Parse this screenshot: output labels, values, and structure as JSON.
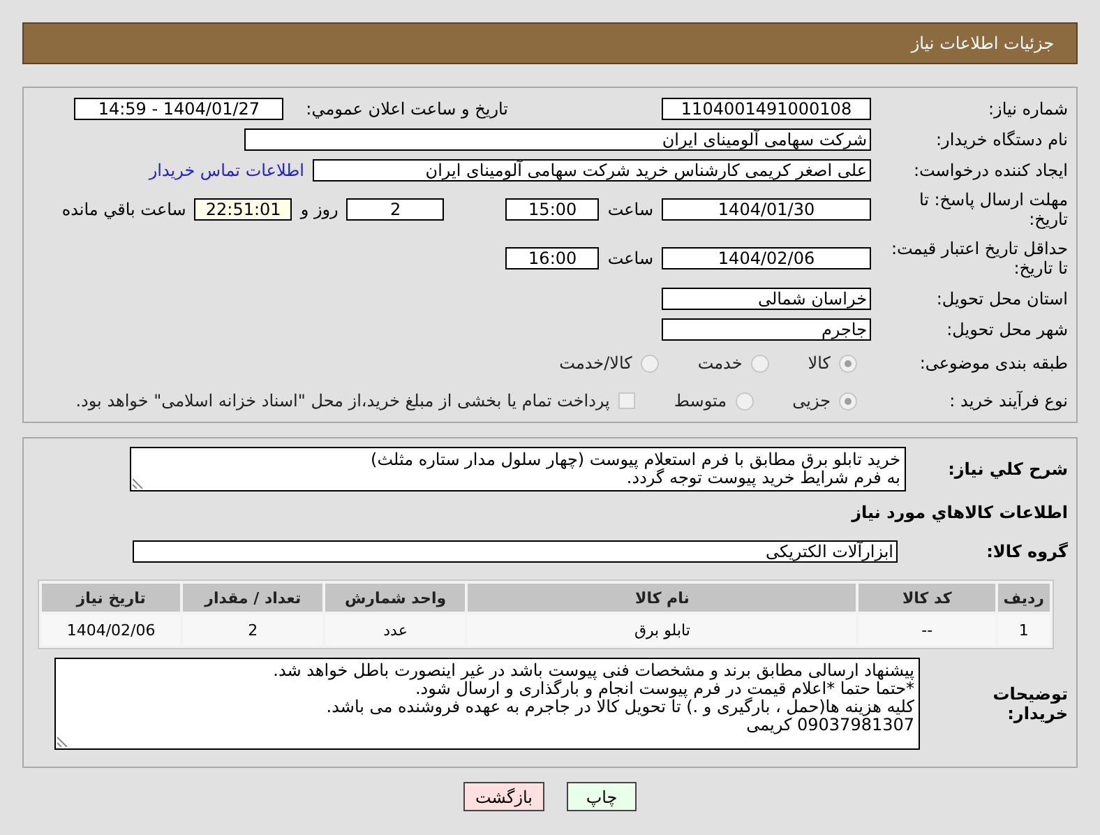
{
  "header": {
    "title": "جزئیات اطلاعات نیاز"
  },
  "details": {
    "need_number": {
      "label": "شماره نیاز:",
      "value": "1104001491000108"
    },
    "announce": {
      "label": "تاریخ و ساعت اعلان عمومي:",
      "value": "1404/01/27 - 14:59"
    },
    "buyer": {
      "label": "نام دستگاه خریدار:",
      "value": "شرکت سهامی آلومینای ایران"
    },
    "creator": {
      "label": "ایجاد کننده درخواست:",
      "value": "علی اصغر کریمی کارشناس خرید شرکت سهامی آلومینای ایران",
      "link": "اطلاعات تماس خریدار"
    },
    "deadline": {
      "label": "مهلت ارسال پاسخ: تا تاریخ:",
      "date": "1404/01/30",
      "time_label": "ساعت",
      "time": "15:00",
      "days": "2",
      "days_label": "روز و",
      "remaining": "22:51:01",
      "remaining_label": "ساعت باقي مانده"
    },
    "validity": {
      "label": "حداقل تاریخ اعتبار قیمت: تا تاریخ:",
      "date": "1404/02/06",
      "time_label": "ساعت",
      "time": "16:00"
    },
    "province": {
      "label": "استان محل تحویل:",
      "value": "خراسان شمالی"
    },
    "city": {
      "label": "شهر محل تحویل:",
      "value": "جاجرم"
    },
    "category": {
      "label": "طبقه بندی موضوعی:",
      "options": [
        {
          "label": "کالا",
          "selected": true
        },
        {
          "label": "خدمت",
          "selected": false
        },
        {
          "label": "کالا/خدمت",
          "selected": false
        }
      ]
    },
    "process": {
      "label": "نوع فرآیند خرید :",
      "options": [
        {
          "label": "جزیی",
          "selected": true
        },
        {
          "label": "متوسط",
          "selected": false
        }
      ],
      "treasury": {
        "label": "پرداخت تمام یا بخشی از مبلغ خرید،از محل \"اسناد خزانه اسلامی\" خواهد بود.",
        "checked": false
      }
    }
  },
  "goods": {
    "description": {
      "label": "شرح کلي نیاز:",
      "value": "خرید تابلو برق مطابق با فرم استعلام پیوست (چهار سلول مدار ستاره مثلث)\nبه فرم شرایط خرید پیوست توجه گردد."
    },
    "heading": "اطلاعات کالاهاي مورد نیاز",
    "group": {
      "label": "گروه کالا:",
      "value": "ابزارآلات الکتریکی"
    },
    "table": {
      "columns": [
        "ردیف",
        "کد کالا",
        "نام کالا",
        "واحد شمارش",
        "تعداد / مقدار",
        "تاریخ نیاز"
      ],
      "rows": [
        [
          "1",
          "--",
          "تابلو برق",
          "عدد",
          "2",
          "1404/02/06"
        ]
      ]
    },
    "notes": {
      "label": "توضیحات خریدار:",
      "value": "پیشنهاد ارسالی مطابق برند و مشخصات فنی پیوست باشد در غیر اینصورت باطل خواهد شد.\n*حتما حتما *اعلام قیمت در فرم پیوست انجام و بارگذاری و ارسال شود.\nکلیه هزینه ها(حمل ، بارگیری و .) تا تحویل کالا در جاجرم به عهده فروشنده می باشد.\n09037981307 کریمی"
    }
  },
  "buttons": [
    {
      "label": "چاپ",
      "kind": "print"
    },
    {
      "label": "بازگشت",
      "kind": "back"
    }
  ]
}
